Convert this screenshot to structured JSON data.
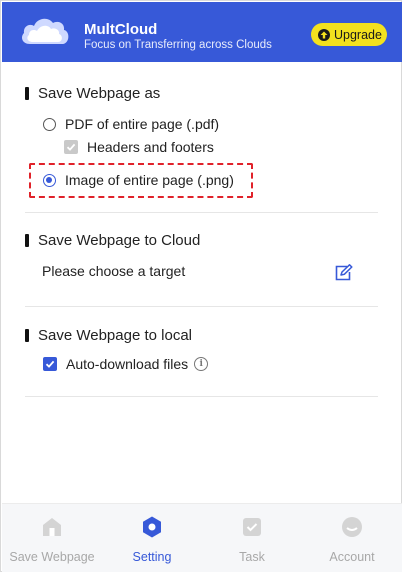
{
  "header": {
    "app_name": "MultCloud",
    "tagline": "Focus on Transferring across Clouds",
    "upgrade_label": "Upgrade"
  },
  "save_as": {
    "title": "Save Webpage as",
    "options": [
      {
        "label": "PDF of entire page (.pdf)",
        "selected": false
      },
      {
        "label": "Image of entire page (.png)",
        "selected": true
      }
    ],
    "headers_footers_label": "Headers and footers"
  },
  "save_to_cloud": {
    "title": "Save Webpage to Cloud",
    "target_prompt": "Please choose a target"
  },
  "save_to_local": {
    "title": "Save Webpage to local",
    "auto_download_label": "Auto-download files"
  },
  "bottom_nav": {
    "items": [
      {
        "label": "Save Webpage",
        "icon": "home-icon"
      },
      {
        "label": "Setting",
        "icon": "settings-icon",
        "active": true
      },
      {
        "label": "Task",
        "icon": "task-icon"
      },
      {
        "label": "Account",
        "icon": "account-icon"
      }
    ]
  },
  "colors": {
    "brand": "#3759d8",
    "upgrade": "#f3e11e",
    "highlight": "#e0222a"
  }
}
